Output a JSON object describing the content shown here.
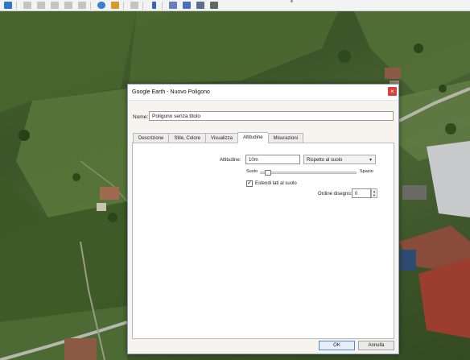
{
  "toolbar": {
    "buttons": [
      {
        "name": "sidebar-toggle-icon",
        "color": "#2d78c8"
      },
      {
        "name": "placemark-icon",
        "color": "#b9b9b9"
      },
      {
        "name": "polygon-icon",
        "color": "#b9b9b9"
      },
      {
        "name": "path-icon",
        "color": "#b9b9b9"
      },
      {
        "name": "overlay-icon",
        "color": "#b9b9b9"
      },
      {
        "name": "tour-icon",
        "color": "#b9b9b9"
      },
      {
        "name": "historical-imagery-icon",
        "color": "#3a7fd0"
      },
      {
        "name": "sunlight-icon",
        "color": "#d49a2a"
      },
      {
        "name": "planets-icon",
        "color": "#b9b9b9"
      },
      {
        "name": "ruler-icon",
        "color": "#3a64b8"
      },
      {
        "name": "email-icon",
        "color": "#6a7fb6"
      },
      {
        "name": "print-icon",
        "color": "#4a6fc0"
      },
      {
        "name": "save-image-icon",
        "color": "#5c6f8c"
      },
      {
        "name": "maps-icon",
        "color": "#5f6a5f"
      }
    ]
  },
  "dialog": {
    "title": "Google Earth - Nuovo Poligono",
    "close_glyph": "×",
    "name_label": "Nome:",
    "name_value": "Poligono senza titolo",
    "tabs": [
      "Descrizione",
      "Stile, Colore",
      "Visualizza",
      "Altitudine",
      "Misurazioni"
    ],
    "active_tab": "Altitudine",
    "altitude": {
      "label": "Altitudine:",
      "value": "10m",
      "mode": "Rispetto al suolo",
      "slider_min_label": "Suolo",
      "slider_max_label": "Spazio",
      "slider_level": 0.05,
      "extend_checked": true,
      "extend_label": "Estendi lati al suolo",
      "draw_order_label": "Ordine disegno:",
      "draw_order_value": "0"
    },
    "ok_label": "OK",
    "cancel_label": "Annulla"
  }
}
